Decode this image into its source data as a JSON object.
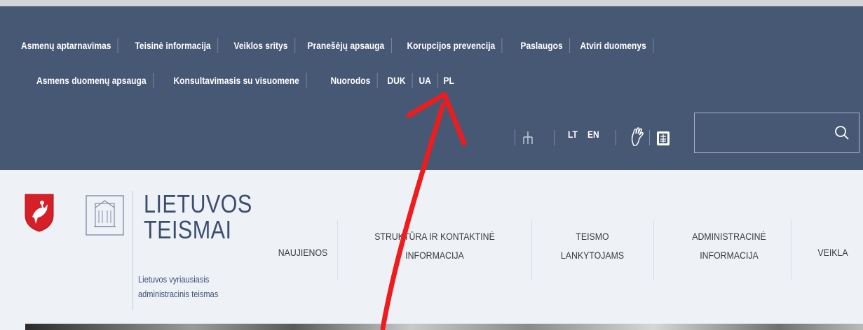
{
  "top_links_row1": [
    "Asmenų aptarnavimas",
    "Teisinė informacija",
    "Veiklos sritys",
    "Pranešėjų apsauga",
    "Korupcijos prevencija",
    "Paslaugos",
    "Atviri duomenys"
  ],
  "top_links_row2": [
    "Asmens duomenų apsauga",
    "Konsultavimasis su visuomene",
    "Nuorodos",
    "DUK",
    "UA",
    "PL"
  ],
  "tools": {
    "icons": [
      "sitemap-icon",
      "sign-language-icon",
      "easy-read-icon",
      "search-icon"
    ],
    "lang_lt": "LT",
    "lang_en": "EN"
  },
  "search": {
    "value": "",
    "placeholder": ""
  },
  "brand": {
    "line1": "LIETUVOS",
    "line2": "TEISMAI",
    "court_line1": "Lietuvos vyriausiasis",
    "court_line2": "administracinis teismas"
  },
  "nav": {
    "news": "NAUJIENOS",
    "structure_line1": "STRUKTŪRA IR KONTAKTINĖ",
    "structure_line2": "INFORMACIJA",
    "visitors_line1": "TEISMO",
    "visitors_line2": "LANKYTOJAMS",
    "admin_line1": "ADMINISTRACINĖ",
    "admin_line2": "INFORMACIJA",
    "activity": "VEIKLA"
  },
  "colors": {
    "topbar": "#475875",
    "header": "#eef2f7",
    "brand_text": "#3b4e70",
    "annotation_arrow": "#ee1c1c"
  }
}
